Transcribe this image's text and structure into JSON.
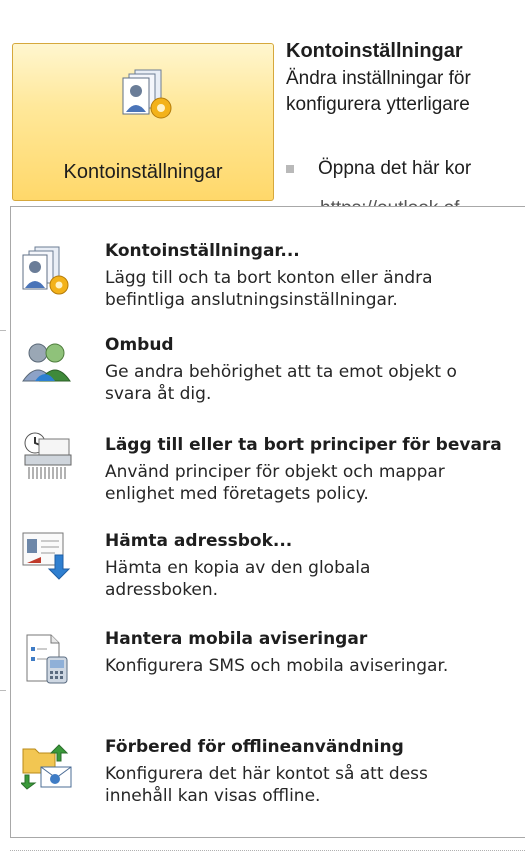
{
  "ribbon": {
    "button_label": "Kontoinställningar",
    "title": "Kontoinställningar",
    "desc_line1": "Ändra inställningar för",
    "desc_line2": "konfigurera ytterligare",
    "bullet_text": "Öppna det här kor",
    "url": "https://outlook.of"
  },
  "menu": {
    "items": [
      {
        "title": "Kontoinställningar...",
        "desc1": "Lägg till och ta bort konton eller ändra",
        "desc2": "befintliga anslutningsinställningar.",
        "icon": "account-settings-icon"
      },
      {
        "title": "Ombud",
        "desc1": "Ge andra behörighet att ta emot objekt o",
        "desc2": "svara åt dig.",
        "icon": "delegates-icon"
      },
      {
        "title": "Lägg till eller ta bort principer för bevara",
        "desc1": "Använd principer för objekt och mappar",
        "desc2": "enlighet med företagets policy.",
        "icon": "retention-policy-icon"
      },
      {
        "title": "Hämta adressbok...",
        "desc1": "Hämta en kopia av den globala",
        "desc2": "adressboken.",
        "icon": "download-address-book-icon"
      },
      {
        "title": "Hantera mobila aviseringar",
        "desc1": "Konfigurera SMS och mobila aviseringar.",
        "desc2": "",
        "icon": "mobile-alerts-icon"
      },
      {
        "title": "Förbered för offlineanvändning",
        "desc1": "Konfigurera det här kontot så att dess",
        "desc2": "innehåll kan visas offline.",
        "icon": "offline-icon"
      }
    ]
  },
  "colors": {
    "button_gradient_top": "#fff6cf",
    "button_gradient_bottom": "#ffd86a",
    "button_border": "#d6a83c"
  }
}
